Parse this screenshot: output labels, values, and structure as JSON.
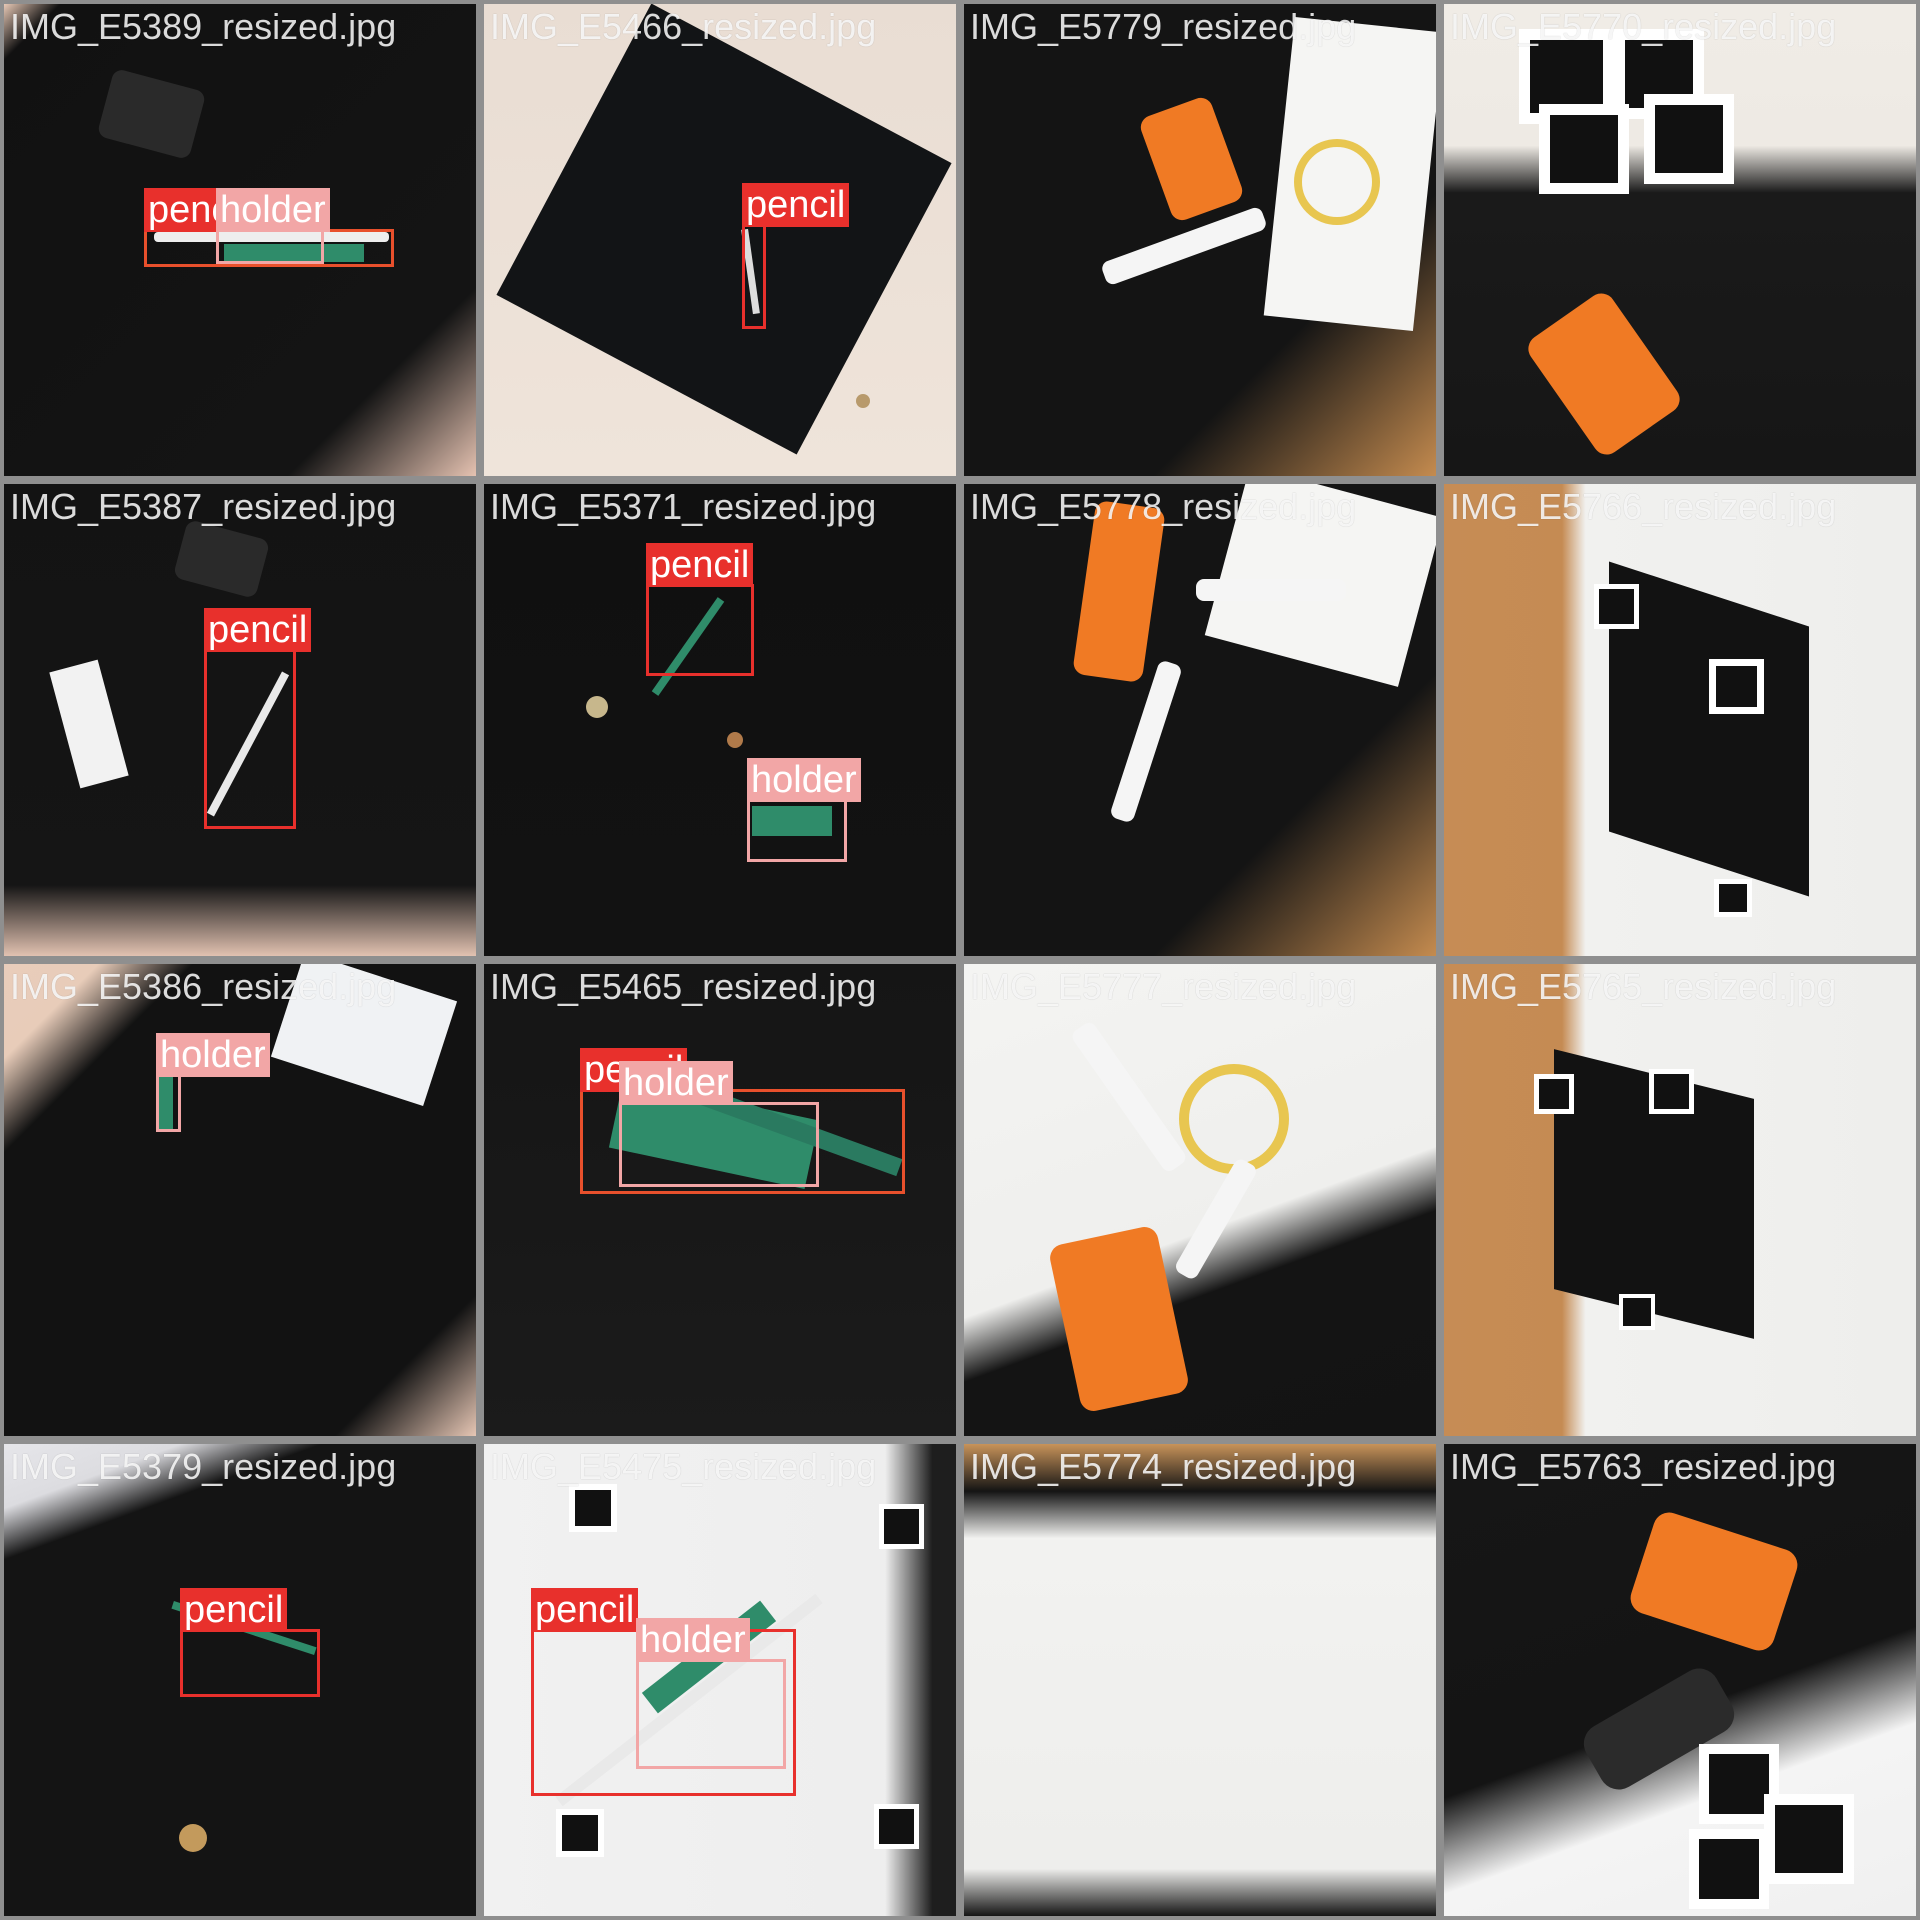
{
  "tiles": [
    {
      "filename": "IMG_E5389_resized.jpg",
      "bg": "linear-gradient(135deg,#e8c9b6 0%,#111 6%,#141414 80%,#e5c2b1 100%)"
    },
    {
      "filename": "IMG_E5466_resized.jpg",
      "bg": "linear-gradient(180deg,#e9ddd3 0%,#efe4da 100%)"
    },
    {
      "filename": "IMG_E5779_resized.jpg",
      "bg": "linear-gradient(135deg,#141414 0%,#141414 70%,#c48b4f 100%)"
    },
    {
      "filename": "IMG_E5770_resized.jpg",
      "bg": "linear-gradient(180deg,#f0ece6 0%,#eeeae4 30%,#1a1a1a 40%,#161616 100%)"
    },
    {
      "filename": "IMG_E5387_resized.jpg",
      "bg": "linear-gradient(180deg,#131313 0%,#151515 85%,#e2c2b1 100%)"
    },
    {
      "filename": "IMG_E5371_resized.jpg",
      "bg": "linear-gradient(180deg,#101010 0%,#121212 100%)"
    },
    {
      "filename": "IMG_E5778_resized.jpg",
      "bg": "linear-gradient(135deg,#141414 0%,#141414 70%,#c48b4f 100%)"
    },
    {
      "filename": "IMG_E5766_resized.jpg",
      "bg": "linear-gradient(90deg,#c68c55 0%,#c58b53 25%,#f1f1ef 30%,#eeeeec 100%)"
    },
    {
      "filename": "IMG_E5386_resized.jpg",
      "bg": "linear-gradient(135deg,#e9cdbb 0%,#e8ccb9 10%,#121212 20%,#121212 85%,#e6c6b4 100%)"
    },
    {
      "filename": "IMG_E5465_resized.jpg",
      "bg": "linear-gradient(180deg,#151515 0%,#1b1b1b 100%)"
    },
    {
      "filename": "IMG_E5777_resized.jpg",
      "bg": "linear-gradient(160deg,#f4f4f2 0%,#efefed 55%,#141414 65%,#131313 100%)"
    },
    {
      "filename": "IMG_E5765_resized.jpg",
      "bg": "linear-gradient(90deg,#c68c55 0%,#c58b53 25%,#f1f1ef 30%,#eeeeec 100%)"
    },
    {
      "filename": "IMG_E5379_resized.jpg",
      "bg": "linear-gradient(160deg,#e6e6ea 0%,#dcdce0 10%,#141414 18%,#141414 100%)"
    },
    {
      "filename": "IMG_E5475_resized.jpg",
      "bg": "linear-gradient(90deg,#f1f1f1 0%,#eeeeee 85%,#1e1e1e 95%)"
    },
    {
      "filename": "IMG_E5774_resized.jpg",
      "bg": "linear-gradient(180deg,#c8935a 0%,#141414 10%,#f2f2f0 20%,#eeeeec 90%,#151515 100%)"
    },
    {
      "filename": "IMG_E5763_resized.jpg",
      "bg": "linear-gradient(160deg,#161616 0%,#141414 55%,#f4f4f4 70%,#f0f0f0 100%)"
    }
  ],
  "labels": {
    "pencil": "pencil",
    "holder": "holder"
  }
}
